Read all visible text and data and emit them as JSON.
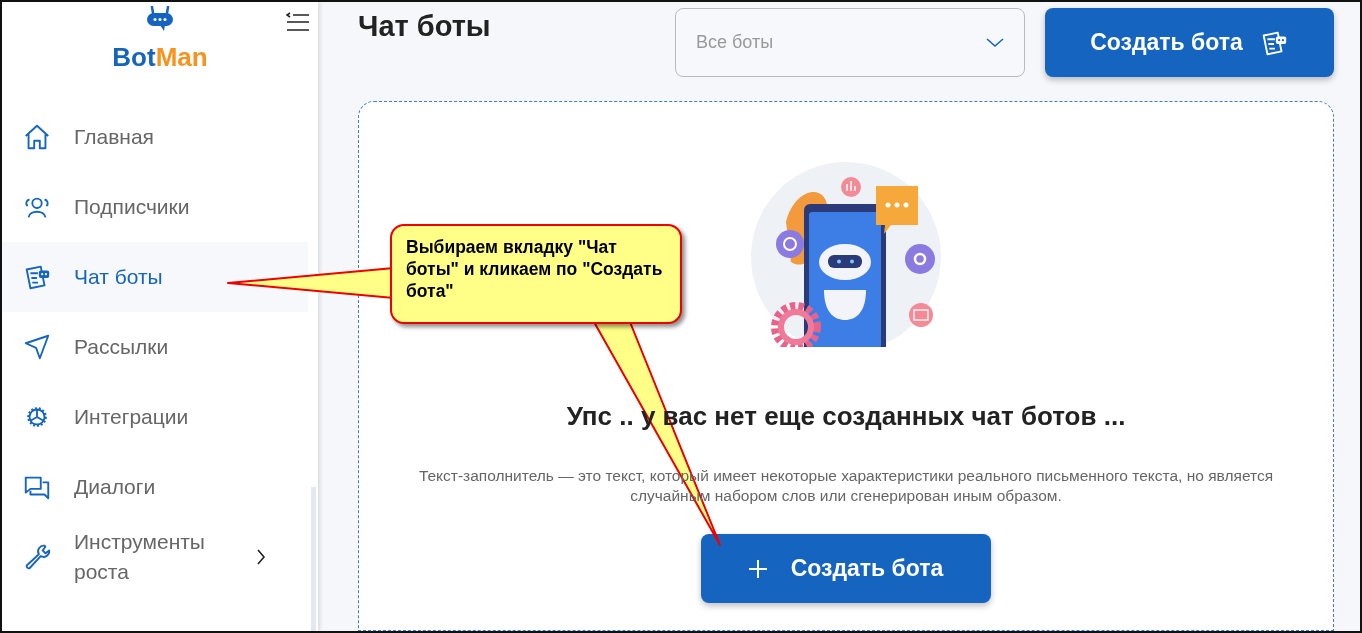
{
  "sidebar": {
    "logo": {
      "parts": [
        "Bot",
        "Man"
      ]
    },
    "items": [
      {
        "label": "Главная",
        "selected": false,
        "has_submenu": false
      },
      {
        "label": "Подписчики",
        "selected": false,
        "has_submenu": false
      },
      {
        "label": "Чат боты",
        "selected": true,
        "has_submenu": false
      },
      {
        "label": "Рассылки",
        "selected": false,
        "has_submenu": false
      },
      {
        "label": "Интеграции",
        "selected": false,
        "has_submenu": false
      },
      {
        "label": "Диалоги",
        "selected": false,
        "has_submenu": false
      },
      {
        "label": "Инструменты роста",
        "selected": false,
        "has_submenu": true
      }
    ]
  },
  "header": {
    "title": "Чат боты",
    "filter": {
      "placeholder": "Все боты"
    },
    "create_button": "Создать бота"
  },
  "empty_state": {
    "heading": "Упс .. у вас нет еще созданных чат ботов ...",
    "description": "Текст-заполнитель — это текст, который имеет некоторые характеристики реального письменного текста, но является случайным набором слов или сгенерирован иным образом.",
    "button": "Создать бота"
  },
  "callout": {
    "text": "Выбираем вкладку \"Чат боты\" и кликаем по \"Создать бота\""
  }
}
